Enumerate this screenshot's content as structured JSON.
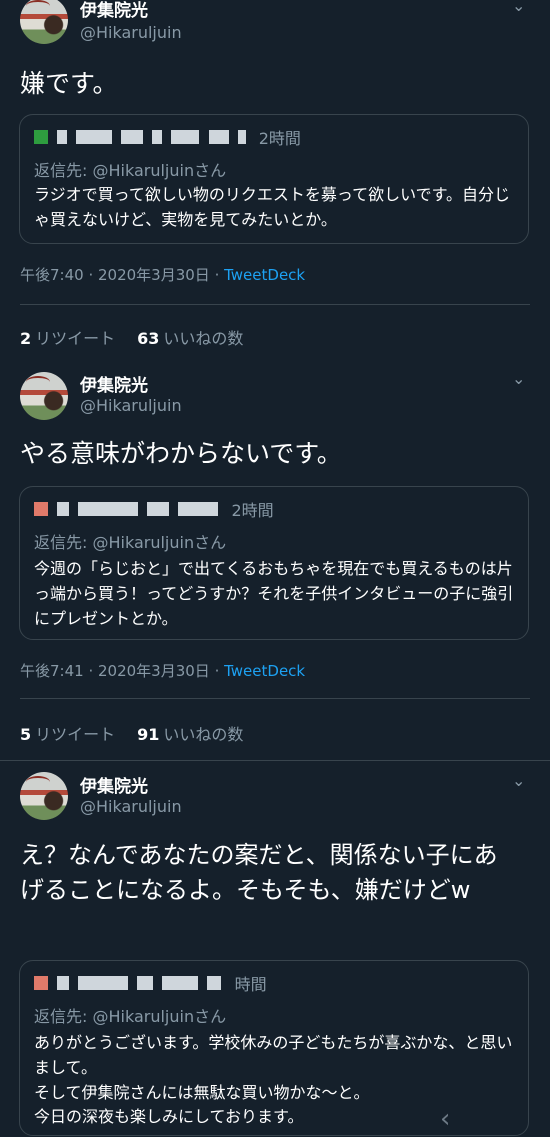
{
  "tweets": [
    {
      "name": "伊集院光",
      "handle": "@Hikaruljuin",
      "text": "嫌です。",
      "quote": {
        "time": "2時間",
        "reply_to": "返信先: @Hikaruljuinさん",
        "text": "ラジオで買って欲しい物のリクエストを募って欲しいです。自分じゃ買えないけど、実物を見てみたいとか。"
      },
      "meta_time": "午後7:40 · 2020年3月30日",
      "meta_sep": " · ",
      "source": "TweetDeck",
      "retweets": "2",
      "retweets_label": "リツイート",
      "likes": "63",
      "likes_label": "いいねの数"
    },
    {
      "name": "伊集院光",
      "handle": "@Hikaruljuin",
      "text": "やる意味がわからないです。",
      "quote": {
        "time": "2時間",
        "reply_to": "返信先: @Hikaruljuinさん",
        "text": "今週の「らじおと」で出てくるおもちゃを現在でも買えるものは片っ端から買う！ってどうすか？それを子供インタビューの子に強引にプレゼントとか。"
      },
      "meta_time": "午後7:41 · 2020年3月30日",
      "meta_sep": " · ",
      "source": "TweetDeck",
      "retweets": "5",
      "retweets_label": "リツイート",
      "likes": "91",
      "likes_label": "いいねの数"
    },
    {
      "name": "伊集院光",
      "handle": "@Hikaruljuin",
      "text": "え？なんであなたの案だと、関係ない子にあげることになるよ。そもそも、嫌だけどw",
      "quote": {
        "time": "時間",
        "reply_to": "返信先: @Hikaruljuinさん",
        "text_lines": [
          "ありがとうございます。学校休みの子どもたちが喜ぶかな、と思いまして。",
          "そして伊集院さんには無駄な買い物かな〜と。",
          "今日の深夜も楽しみにしております。"
        ]
      }
    }
  ],
  "navbar": {
    "back_icon": "‹"
  },
  "colors": {
    "background": "#15202b",
    "secondary_text": "#8899a6",
    "link": "#1da1f2",
    "border": "#38444d"
  }
}
